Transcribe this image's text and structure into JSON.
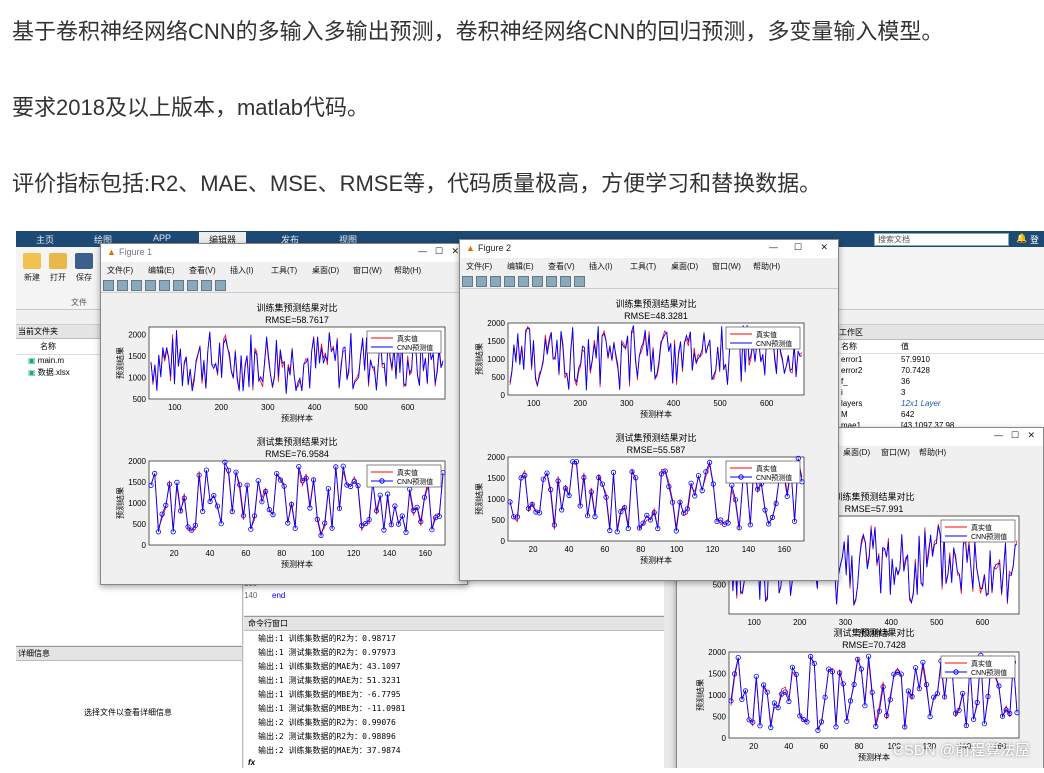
{
  "article": {
    "line1": "基于卷积神经网络CNN的多输入多输出预测，卷积神经网络CNN的回归预测，多变量输入模型。",
    "line2": "要求2018及以上版本，matlab代码。",
    "line3": "评价指标包括:R2、MAE、MSE、RMSE等，代码质量极高，方便学习和替换数据。"
  },
  "matlab": {
    "tabs": [
      "主页",
      "绘图",
      "APP",
      "编辑器",
      "发布",
      "视图"
    ],
    "active_tab": "编辑器",
    "ribbon_buttons": [
      "新建",
      "打开",
      "保存"
    ],
    "ribbon_group": "文件",
    "search_placeholder": "搜索文档",
    "login": "登",
    "current_folder_title": "当前文件夹",
    "folder_header": "名称",
    "files": [
      "main.m",
      "数据.xlsx"
    ],
    "details_title": "详细信息",
    "details_hint": "选择文件以查看详细信息",
    "workspace_title": "工作区",
    "ws_header_name": "名称",
    "ws_header_value": "值",
    "workspace": [
      {
        "name": "error1",
        "value": "57.9910"
      },
      {
        "name": "error2",
        "value": "70.7428"
      },
      {
        "name": "f_",
        "value": "36"
      },
      {
        "name": "i",
        "value": "3"
      },
      {
        "name": "layers",
        "value": "12x1 Layer"
      },
      {
        "name": "M",
        "value": "642"
      },
      {
        "name": "mae1",
        "value": "[43.1097,37.98"
      }
    ],
    "editor_lines": [
      {
        "num": "139",
        "code": ""
      },
      {
        "num": "140",
        "code": "end"
      }
    ],
    "cmd_title": "命令行窗口",
    "cmd_prompt": "fx",
    "cmd_lines": [
      "输出:1   训练集数据的R2为：0.98717",
      "输出:1   测试集数据的R2为：0.97973",
      "输出:1   训练集数据的MAE为：43.1097",
      "输出:1   测试集数据的MAE为：51.3231",
      "输出:1   训练集数据的MBE为：-6.7795",
      "输出:1   测试集数据的MBE为：-11.0981",
      "输出:2   训练集数据的R2为：0.99076",
      "输出:2   测试集数据的R2为：0.98896",
      "输出:2   训练集数据的MAE为：37.9874"
    ]
  },
  "figures": [
    {
      "title": "Figure 1",
      "menu": [
        "文件(F)",
        "编辑(E)",
        "查看(V)",
        "插入(I)",
        "工具(T)",
        "桌面(D)",
        "窗口(W)",
        "帮助(H)"
      ],
      "plots": [
        {
          "title": "训练集预测结果对比",
          "rmse": "RMSE=58.7617",
          "ylabel": "预测结果",
          "xlabel": "预测样本",
          "ticks_x": [
            "100",
            "200",
            "300",
            "400",
            "500",
            "600"
          ],
          "ticks_y": [
            "500",
            "1000",
            "1500",
            "2000"
          ]
        },
        {
          "title": "测试集预测结果对比",
          "rmse": "RMSE=76.9584",
          "ylabel": "预测结果",
          "xlabel": "预测样本",
          "ticks_x": [
            "20",
            "40",
            "60",
            "80",
            "100",
            "120",
            "140",
            "160"
          ],
          "ticks_y": [
            "0",
            "500",
            "1000",
            "1500",
            "2000"
          ]
        }
      ],
      "legend": [
        "真实值",
        "CNN预测值"
      ]
    },
    {
      "title": "Figure 2",
      "menu": [
        "文件(F)",
        "编辑(E)",
        "查看(V)",
        "插入(I)",
        "工具(T)",
        "桌面(D)",
        "窗口(W)",
        "帮助(H)"
      ],
      "plots": [
        {
          "title": "训练集预测结果对比",
          "rmse": "RMSE=48.3281",
          "ylabel": "预测结果",
          "xlabel": "预测样本",
          "ticks_x": [
            "100",
            "200",
            "300",
            "400",
            "500",
            "600"
          ],
          "ticks_y": [
            "0",
            "500",
            "1000",
            "1500",
            "2000"
          ]
        },
        {
          "title": "测试集预测结果对比",
          "rmse": "RMSE=55.587",
          "ylabel": "预测结果",
          "xlabel": "预测样本",
          "ticks_x": [
            "20",
            "40",
            "60",
            "80",
            "100",
            "120",
            "140",
            "160"
          ],
          "ticks_y": [
            "0",
            "500",
            "1000",
            "1500",
            "2000"
          ]
        }
      ],
      "legend": [
        "真实值",
        "CNN预测值"
      ]
    },
    {
      "title": "",
      "menu": [
        "桌面(D)",
        "窗口(W)",
        "帮助(H)"
      ],
      "plots": [
        {
          "title": "训练集预测结果对比",
          "rmse": "RMSE=57.991",
          "ylabel": "",
          "xlabel": "预测样本",
          "ticks_x": [
            "100",
            "200",
            "300",
            "400",
            "500",
            "600"
          ],
          "ticks_y": [
            "500"
          ]
        },
        {
          "title": "测试集预测结果对比",
          "rmse": "RMSE=70.7428",
          "ylabel": "预测结果",
          "xlabel": "预测样本",
          "ticks_x": [
            "20",
            "40",
            "60",
            "80",
            "100",
            "120",
            "140",
            "160"
          ],
          "ticks_y": [
            "0",
            "500",
            "1000",
            "1500",
            "2000"
          ]
        }
      ],
      "legend": [
        "真实值",
        "CNN预测值"
      ]
    }
  ],
  "colors": {
    "true_series": "#ff0000",
    "pred_series": "#0000ff",
    "ribbon": "#1c4a75"
  },
  "watermark": "CSDN @前程算法屋"
}
